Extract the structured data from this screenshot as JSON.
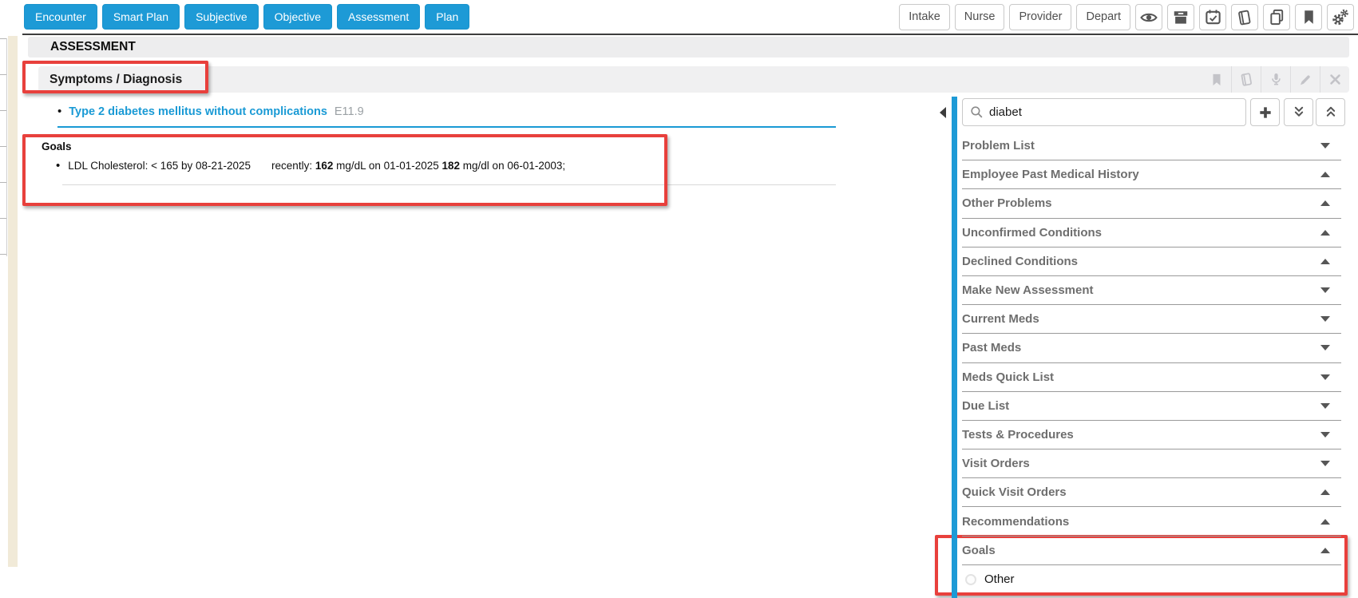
{
  "toolbar": {
    "nav": [
      "Encounter",
      "Smart Plan",
      "Subjective",
      "Objective",
      "Assessment",
      "Plan"
    ],
    "stages": [
      "Intake",
      "Nurse",
      "Provider",
      "Depart"
    ],
    "icon_buttons": [
      "eye",
      "archive-box",
      "calendar-check",
      "book",
      "copy",
      "bookmark",
      "gears"
    ]
  },
  "assessment": {
    "title": "ASSESSMENT"
  },
  "diagnosis": {
    "header": "Symptoms / Diagnosis",
    "header_icons": [
      "bookmark",
      "book",
      "microphone",
      "pencil",
      "close"
    ],
    "item": {
      "label": "Type 2 diabetes mellitus without complications",
      "code": "E11.9"
    },
    "goals": {
      "title": "Goals",
      "line": {
        "lead": "LDL Cholesterol: < 165 by 08-21-2025",
        "recent_label": "recently:",
        "value1": "162",
        "tail1": "mg/dL on 01-01-2025",
        "value2": "182",
        "tail2": "mg/dl on 06-01-2003;"
      }
    }
  },
  "sidebar": {
    "search": {
      "value": "diabet"
    },
    "action_icons": [
      "collapse-left",
      "search",
      "add",
      "double-chevron-down",
      "double-chevron-up"
    ],
    "sections": [
      {
        "label": "Problem List",
        "caret": "down"
      },
      {
        "label": "Employee Past Medical History",
        "caret": "up"
      },
      {
        "label": "Other Problems",
        "caret": "up"
      },
      {
        "label": "Unconfirmed Conditions",
        "caret": "up"
      },
      {
        "label": "Declined Conditions",
        "caret": "up"
      },
      {
        "label": "Make New Assessment",
        "caret": "down"
      },
      {
        "label": "Current Meds",
        "caret": "down"
      },
      {
        "label": "Past Meds",
        "caret": "down"
      },
      {
        "label": "Meds Quick List",
        "caret": "down"
      },
      {
        "label": "Due List",
        "caret": "down"
      },
      {
        "label": "Tests & Procedures",
        "caret": "down"
      },
      {
        "label": "Visit Orders",
        "caret": "down"
      },
      {
        "label": "Quick Visit Orders",
        "caret": "up"
      },
      {
        "label": "Recommendations",
        "caret": "up"
      },
      {
        "label": "Goals",
        "caret": "up"
      }
    ],
    "other_option": {
      "label": "Other"
    }
  },
  "colors": {
    "accent_blue": "#1D9AD6",
    "link_blue": "#1A9AD5",
    "annotation_red": "#E8403C",
    "beige_strip": "#F1EAD8"
  }
}
